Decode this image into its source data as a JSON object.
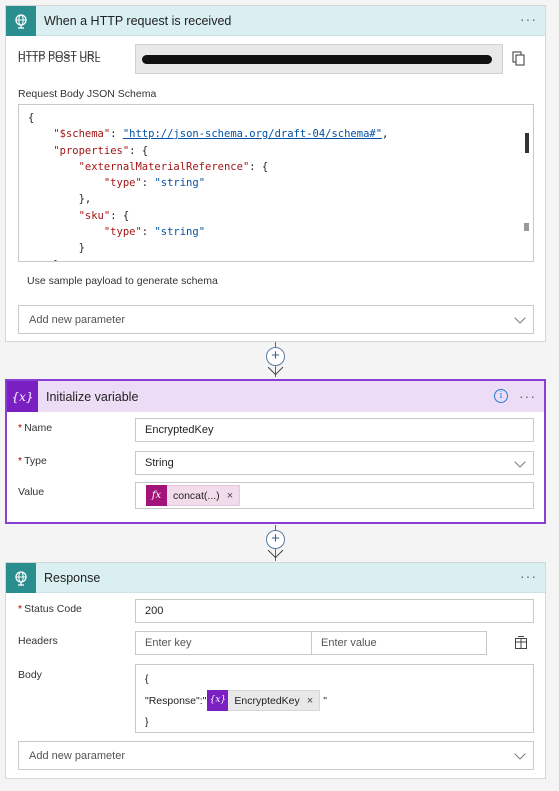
{
  "trigger": {
    "title": "When a HTTP request is received",
    "more": "···",
    "http_post_url_label": "HTTP POST URL",
    "schema_label": "Request Body JSON Schema",
    "schema_lines": [
      [
        {
          "t": "pun",
          "v": "{"
        }
      ],
      [
        {
          "t": "pun",
          "v": "    "
        },
        {
          "t": "key",
          "v": "\"$schema\""
        },
        {
          "t": "pun",
          "v": ": "
        },
        {
          "t": "str",
          "v": "\"http://json-schema.org/draft-04/schema#\""
        },
        {
          "t": "pun",
          "v": ","
        }
      ],
      [
        {
          "t": "pun",
          "v": "    "
        },
        {
          "t": "key",
          "v": "\"properties\""
        },
        {
          "t": "pun",
          "v": ": {"
        }
      ],
      [
        {
          "t": "pun",
          "v": "        "
        },
        {
          "t": "key",
          "v": "\"externalMaterialReference\""
        },
        {
          "t": "pun",
          "v": ": {"
        }
      ],
      [
        {
          "t": "pun",
          "v": "            "
        },
        {
          "t": "key",
          "v": "\"type\""
        },
        {
          "t": "pun",
          "v": ": "
        },
        {
          "t": "str",
          "v": "\"string\""
        }
      ],
      [
        {
          "t": "pun",
          "v": "        },"
        }
      ],
      [
        {
          "t": "pun",
          "v": "        "
        },
        {
          "t": "key",
          "v": "\"sku\""
        },
        {
          "t": "pun",
          "v": ": {"
        }
      ],
      [
        {
          "t": "pun",
          "v": "            "
        },
        {
          "t": "key",
          "v": "\"type\""
        },
        {
          "t": "pun",
          "v": ": "
        },
        {
          "t": "str",
          "v": "\"string\""
        }
      ],
      [
        {
          "t": "pun",
          "v": "        }"
        }
      ],
      [
        {
          "t": "pun",
          "v": "    }"
        }
      ]
    ],
    "sample_payload_link": "Use sample payload to generate schema",
    "add_param_label": "Add new parameter"
  },
  "init_var": {
    "title": "Initialize variable",
    "icon_text": "{x}",
    "info": "i",
    "more": "···",
    "name_label": "Name",
    "name_value": "EncryptedKey",
    "type_label": "Type",
    "type_value": "String",
    "value_label": "Value",
    "value_token": "concat(...)",
    "fx": "fx",
    "token_close": "×"
  },
  "response": {
    "title": "Response",
    "more": "···",
    "status_label": "Status Code",
    "status_value": "200",
    "headers_label": "Headers",
    "header_key_placeholder": "Enter key",
    "header_value_placeholder": "Enter value",
    "body_label": "Body",
    "body_open": "{",
    "body_prefix": "\"Response\":\"",
    "body_token": "EncryptedKey",
    "body_token_icon": "{x}",
    "body_suffix": "\"",
    "body_close": "}",
    "token_close": "×",
    "add_param_label": "Add new parameter"
  },
  "connector_plus": "+",
  "colors": {
    "trigger_header": "#d9eff2",
    "trigger_icon": "#2b8e8e",
    "variable_header": "#ecdcf5",
    "variable_accent": "#7a1fc2",
    "expression_token": "#a3147a"
  }
}
